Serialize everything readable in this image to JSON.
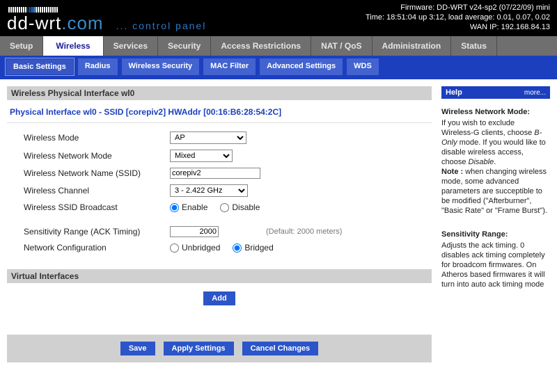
{
  "brand": {
    "name": "dd-wrt",
    "suffix": ".com",
    "cp": "... control panel"
  },
  "header_info": {
    "firmware": "Firmware: DD-WRT v24-sp2 (07/22/09) mini",
    "time": "Time: 18:51:04 up 3:12, load average: 0.01, 0.07, 0.02",
    "wan": "WAN IP: 192.168.84.13"
  },
  "tabs": {
    "setup": "Setup",
    "wireless": "Wireless",
    "services": "Services",
    "security": "Security",
    "access": "Access Restrictions",
    "nat": "NAT / QoS",
    "admin": "Administration",
    "status": "Status"
  },
  "subtabs": {
    "basic": "Basic Settings",
    "radius": "Radius",
    "wsec": "Wireless Security",
    "mac": "MAC Filter",
    "adv": "Advanced Settings",
    "wds": "WDS"
  },
  "section": {
    "phys_title": "Wireless Physical Interface wl0",
    "iface_line": "Physical Interface wl0 - SSID [corepiv2] HWAddr [00:16:B6:28:54:2C]",
    "labels": {
      "mode": "Wireless Mode",
      "netmode": "Wireless Network Mode",
      "ssid": "Wireless Network Name (SSID)",
      "channel": "Wireless Channel",
      "broadcast": "Wireless SSID Broadcast",
      "ack": "Sensitivity Range (ACK Timing)",
      "netconf": "Network Configuration"
    },
    "values": {
      "mode": "AP",
      "netmode": "Mixed",
      "ssid": "corepiv2",
      "channel": "3 - 2.422 GHz",
      "enable": "Enable",
      "disable": "Disable",
      "ack": "2000",
      "ack_default": "(Default: 2000 meters)",
      "unbridged": "Unbridged",
      "bridged": "Bridged"
    },
    "virt_title": "Virtual Interfaces",
    "add": "Add"
  },
  "buttons": {
    "save": "Save",
    "apply": "Apply Settings",
    "cancel": "Cancel Changes"
  },
  "help": {
    "title": "Help",
    "more": "more...",
    "h1": "Wireless Network Mode:",
    "p1a": "If you wish to exclude Wireless-G clients, choose ",
    "p1b": "B-Only",
    "p1c": " mode. If you would like to disable wireless access, choose ",
    "p1d": "Disable",
    "p1e": ".",
    "p1note": "Note :",
    "p1f": " when changing wireless mode, some advanced parameters are succeptible to be modified (\"Afterburner\", \"Basic Rate\" or \"Frame Burst\").",
    "h2": "Sensitivity Range:",
    "p2": "Adjusts the ack timing. 0 disables ack timing completely for broadcom firmwares. On Atheros based firmwares it will turn into auto ack timing mode"
  }
}
